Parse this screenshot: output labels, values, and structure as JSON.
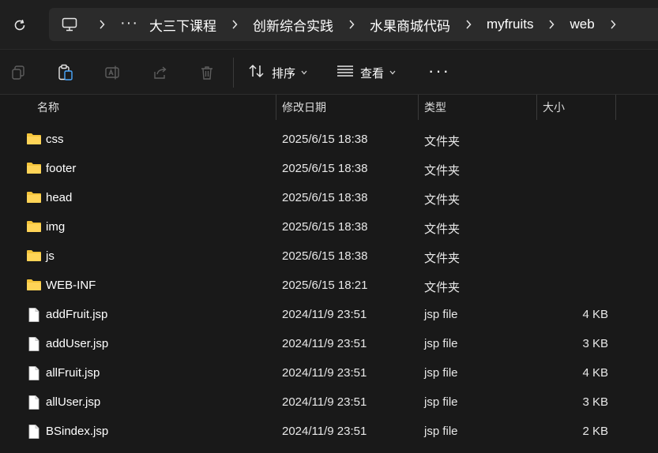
{
  "address": {
    "separator": ">",
    "overflow": "···",
    "path": [
      "大三下课程",
      "创新综合实践",
      "水果商城代码",
      "myfruits",
      "web"
    ]
  },
  "toolbar": {
    "sort_label": "排序",
    "view_label": "查看",
    "more_label": "···",
    "icons": [
      "copy-icon",
      "paste-icon",
      "rename-icon",
      "share-icon",
      "delete-icon",
      "sort-icon",
      "view-icon"
    ]
  },
  "columns": {
    "name": "名称",
    "modified": "修改日期",
    "type": "类型",
    "size": "大小"
  },
  "colors": {
    "background": "#191919",
    "folder": "#f4c43a",
    "breadcrumb_bg": "#2b2b2b"
  },
  "files": [
    {
      "name": "css",
      "date": "2025/6/15 18:38",
      "type": "文件夹",
      "size": "",
      "kind": "folder"
    },
    {
      "name": "footer",
      "date": "2025/6/15 18:38",
      "type": "文件夹",
      "size": "",
      "kind": "folder"
    },
    {
      "name": "head",
      "date": "2025/6/15 18:38",
      "type": "文件夹",
      "size": "",
      "kind": "folder"
    },
    {
      "name": "img",
      "date": "2025/6/15 18:38",
      "type": "文件夹",
      "size": "",
      "kind": "folder"
    },
    {
      "name": "js",
      "date": "2025/6/15 18:38",
      "type": "文件夹",
      "size": "",
      "kind": "folder"
    },
    {
      "name": "WEB-INF",
      "date": "2025/6/15 18:21",
      "type": "文件夹",
      "size": "",
      "kind": "folder"
    },
    {
      "name": "addFruit.jsp",
      "date": "2024/11/9 23:51",
      "type": "jsp file",
      "size": "4 KB",
      "kind": "file"
    },
    {
      "name": "addUser.jsp",
      "date": "2024/11/9 23:51",
      "type": "jsp file",
      "size": "3 KB",
      "kind": "file"
    },
    {
      "name": "allFruit.jsp",
      "date": "2024/11/9 23:51",
      "type": "jsp file",
      "size": "4 KB",
      "kind": "file"
    },
    {
      "name": "allUser.jsp",
      "date": "2024/11/9 23:51",
      "type": "jsp file",
      "size": "3 KB",
      "kind": "file"
    },
    {
      "name": "BSindex.jsp",
      "date": "2024/11/9 23:51",
      "type": "jsp file",
      "size": "2 KB",
      "kind": "file"
    }
  ]
}
